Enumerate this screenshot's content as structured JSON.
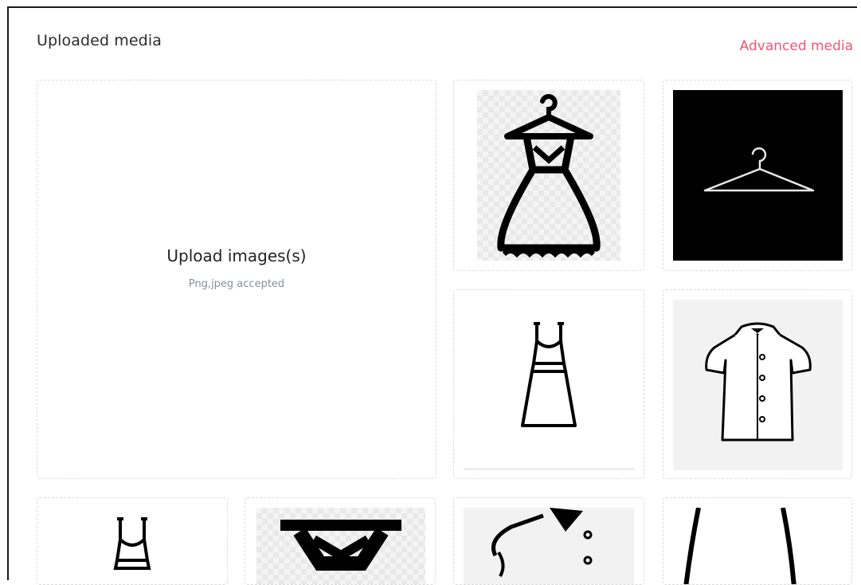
{
  "header": {
    "title": "Uploaded media",
    "advanced_link": "Advanced media"
  },
  "upload": {
    "title": "Upload images(s)",
    "subtitle": "Png,jpeg accepted"
  },
  "media": [
    {
      "icon": "dress-on-hanger-icon"
    },
    {
      "icon": "hanger-icon"
    },
    {
      "icon": "dress-icon"
    },
    {
      "icon": "blouse-icon"
    },
    {
      "icon": "dress-icon"
    },
    {
      "icon": "dress-on-hanger-icon"
    },
    {
      "icon": "shirt-icon"
    },
    {
      "icon": "dress-icon"
    }
  ],
  "colors": {
    "accent": "#f0566f",
    "tile_border": "#dcdcdc",
    "frame": "#1a1a1a"
  }
}
